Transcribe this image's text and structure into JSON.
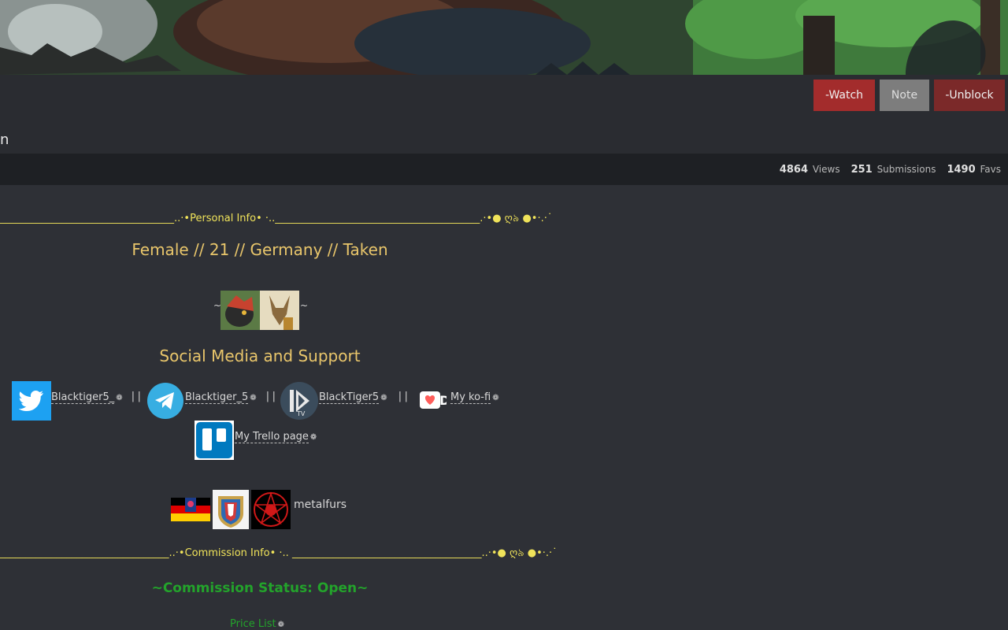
{
  "header": {
    "username_fragment": "n",
    "buttons": {
      "watch": "-Watch",
      "note": "Note",
      "unblock": "-Unblock"
    }
  },
  "stats": [
    {
      "value": "4864",
      "label": "Views"
    },
    {
      "value": "251",
      "label": "Submissions"
    },
    {
      "value": "1490",
      "label": "Favs"
    }
  ],
  "profile": {
    "personal_divider": "__________________________________..·•Personal Info• ·..________________________________________.·•● ღ৯ ●•·.·˙",
    "personal_line": "Female // 21 // Germany // Taken",
    "tilde_left": "~",
    "tilde_right": "~",
    "social_heading": "Social Media and Support",
    "social_links": {
      "twitter": "Blacktiger5_",
      "telegram": "Blacktiger_5",
      "picarto": "BlackTiger5",
      "kofi": "My ko-fi",
      "trello": "My Trello page"
    },
    "separator": "||",
    "kofi_logo_letter": "D",
    "picarto_badge": "TV",
    "paw_glyph": "❁",
    "metalfurs_label": "metalfurs",
    "commission_divider": "_________________________________..·•Commission Info• ·.. _____________________________________..·•● ღ৯ ●•·.·˙",
    "commission_status": "~Commission Status: Open~",
    "price_list": "Price List"
  },
  "colors": {
    "accent_watch": "#a32c2c",
    "accent_note": "#7d7d7d",
    "accent_unblock": "#7b2929",
    "heading_yellow": "#e9c66b",
    "divider_yellow": "#f0e35a",
    "status_green": "#23a32b"
  }
}
